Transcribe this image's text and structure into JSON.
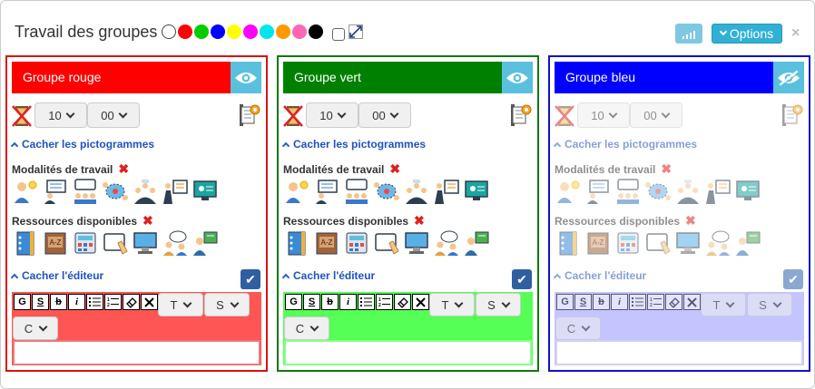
{
  "header": {
    "title": "Travail des groupes",
    "colors": [
      "#ffffff",
      "#ff0000",
      "#00cc00",
      "#0000ff",
      "#ffff00",
      "#ff00ff",
      "#00e5ee",
      "#ff9900",
      "#ff66b3",
      "#000000"
    ],
    "options_label": "Options",
    "close_label": "×"
  },
  "panels": [
    {
      "name": "Groupe rouge",
      "color": "#ff0000",
      "border": "#dd1111",
      "editor_bg": "#ff5555",
      "minutes": "10",
      "seconds": "00",
      "hide_pictos": "Cacher les pictogrammes",
      "modalites": "Modalités de travail",
      "ressources": "Ressources disponibles",
      "hide_editor": "Cacher l'éditeur",
      "sel_t": "T",
      "sel_s": "S",
      "sel_c": "C",
      "eye": "visible",
      "enabled": true
    },
    {
      "name": "Groupe vert",
      "color": "#008000",
      "border": "#117711",
      "editor_bg": "#55ff55",
      "minutes": "10",
      "seconds": "00",
      "hide_pictos": "Cacher les pictogrammes",
      "modalites": "Modalités de travail",
      "ressources": "Ressources disponibles",
      "hide_editor": "Cacher l'éditeur",
      "sel_t": "T",
      "sel_s": "S",
      "sel_c": "C",
      "eye": "visible",
      "enabled": true
    },
    {
      "name": "Groupe bleu",
      "color": "#0000ff",
      "border": "#1111cc",
      "editor_bg": "#c4c4ff",
      "minutes": "10",
      "seconds": "00",
      "hide_pictos": "Cacher les pictogrammes",
      "modalites": "Modalités de travail",
      "ressources": "Ressources disponibles",
      "hide_editor": "Cacher l'éditeur",
      "sel_t": "T",
      "sel_s": "S",
      "sel_c": "C",
      "eye": "hidden",
      "enabled": false
    }
  ],
  "toolbar": [
    "G",
    "S",
    "b",
    "i",
    "list-bullet",
    "list-number",
    "eraser",
    "clear"
  ],
  "icons": {
    "modalites": [
      "individual-idea-icon",
      "presentation-icon",
      "group-discussion-icon",
      "brainstorm-icon",
      "group-work-icon",
      "teacher-board-icon",
      "online-lesson-icon"
    ],
    "ressources": [
      "binder-icon",
      "dictionary-icon",
      "calculator-icon",
      "tablet-icon",
      "computer-icon",
      "peer-help-icon",
      "teacher-help-icon"
    ]
  }
}
